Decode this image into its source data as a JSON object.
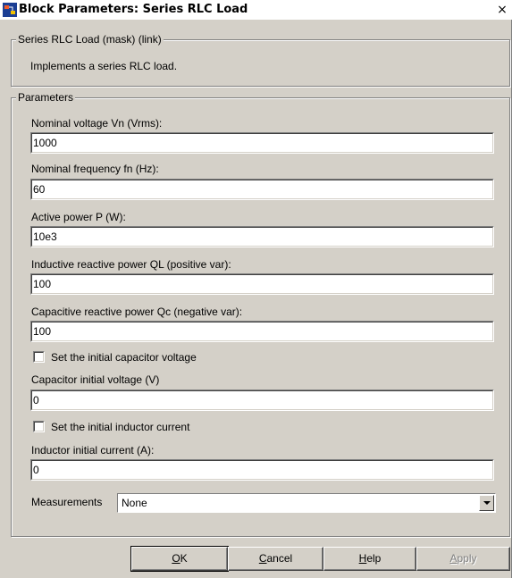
{
  "window": {
    "title": "Block Parameters: Series RLC Load",
    "icon": "simulink-block-icon",
    "close_symbol": "×"
  },
  "mask_group": {
    "legend": "Series RLC Load (mask) (link)",
    "description": "Implements a series RLC load."
  },
  "params_group": {
    "legend": "Parameters",
    "vn_label": "Nominal voltage Vn (Vrms):",
    "vn_value": "1000",
    "fn_label": "Nominal frequency fn (Hz):",
    "fn_value": "60",
    "p_label": "Active power P (W):",
    "p_value": "10e3",
    "ql_label": "Inductive reactive power QL (positive var):",
    "ql_value": "100",
    "qc_label": "Capacitive reactive power Qc (negative var):",
    "qc_value": "100",
    "set_cap_label": "Set the initial capacitor voltage",
    "set_cap_checked": false,
    "cap_v_label": "Capacitor initial voltage (V)",
    "cap_v_value": "0",
    "set_ind_label": "Set the initial inductor current",
    "set_ind_checked": false,
    "ind_i_label": "Inductor initial current (A):",
    "ind_i_value": "0",
    "meas_label": "Measurements",
    "meas_value": "None"
  },
  "buttons": {
    "ok_mn": "O",
    "ok_rest": "K",
    "cancel_mn": "C",
    "cancel_rest": "ancel",
    "help_mn": "H",
    "help_rest": "elp",
    "apply_mn": "A",
    "apply_rest": "pply"
  }
}
